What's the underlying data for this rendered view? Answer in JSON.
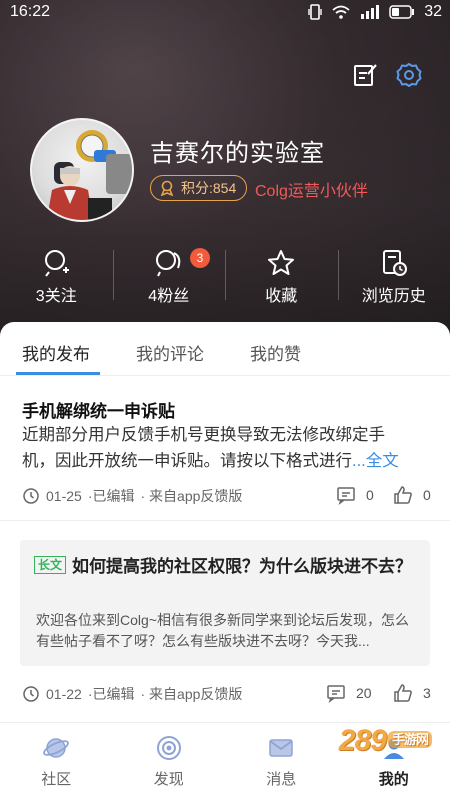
{
  "status_bar": {
    "time": "16:22",
    "battery": "32"
  },
  "profile": {
    "name": "吉赛尔的实验室",
    "points_label": "积分:854",
    "partner_title": "Colg运营小伙伴"
  },
  "stats": [
    {
      "label": "3关注",
      "icon": "follow-icon"
    },
    {
      "label": "4粉丝",
      "icon": "fans-icon",
      "badge": "3"
    },
    {
      "label": "收藏",
      "icon": "star-icon"
    },
    {
      "label": "浏览历史",
      "icon": "history-icon"
    }
  ],
  "tabs": [
    {
      "label": "我的发布",
      "active": true
    },
    {
      "label": "我的评论",
      "active": false
    },
    {
      "label": "我的赞",
      "active": false
    }
  ],
  "posts": [
    {
      "title": "手机解绑统一申诉贴",
      "body_line1": " 近期部分用户反馈手机号更换导致无法修改绑定手",
      "body_line2": "机，因此开放统一申诉贴。请按以下格式进行",
      "ellipsis": "...",
      "more_label": "全文",
      "date": "01-25",
      "edited": "·已编辑",
      "source": "· 来自app反馈版",
      "comments": "0",
      "likes": "0"
    },
    {
      "tag": "长文",
      "title": "如何提高我的社区权限？为什么版块进不去？",
      "body": " 欢迎各位来到Colg~相信有很多新同学来到论坛后发现，怎么有些帖子看不了呀？怎么有些版块进不去呀？今天我...",
      "date": "01-22",
      "edited": "·已编辑",
      "source": "· 来自app反馈版",
      "comments": "20",
      "likes": "3"
    }
  ],
  "bottom_nav": [
    {
      "label": "社区",
      "icon": "planet-icon",
      "active": false
    },
    {
      "label": "发现",
      "icon": "discover-icon",
      "active": false
    },
    {
      "label": "消息",
      "icon": "mail-icon",
      "active": false
    },
    {
      "label": "我的",
      "icon": "profile-icon",
      "active": true
    }
  ],
  "watermark": {
    "brand": "289",
    "suffix": "手游网"
  },
  "colors": {
    "accent": "#3a8de0",
    "partner": "#ef5a5a",
    "points": "#e8a24a",
    "badge": "#f15a3a",
    "tag": "#35b35a"
  }
}
